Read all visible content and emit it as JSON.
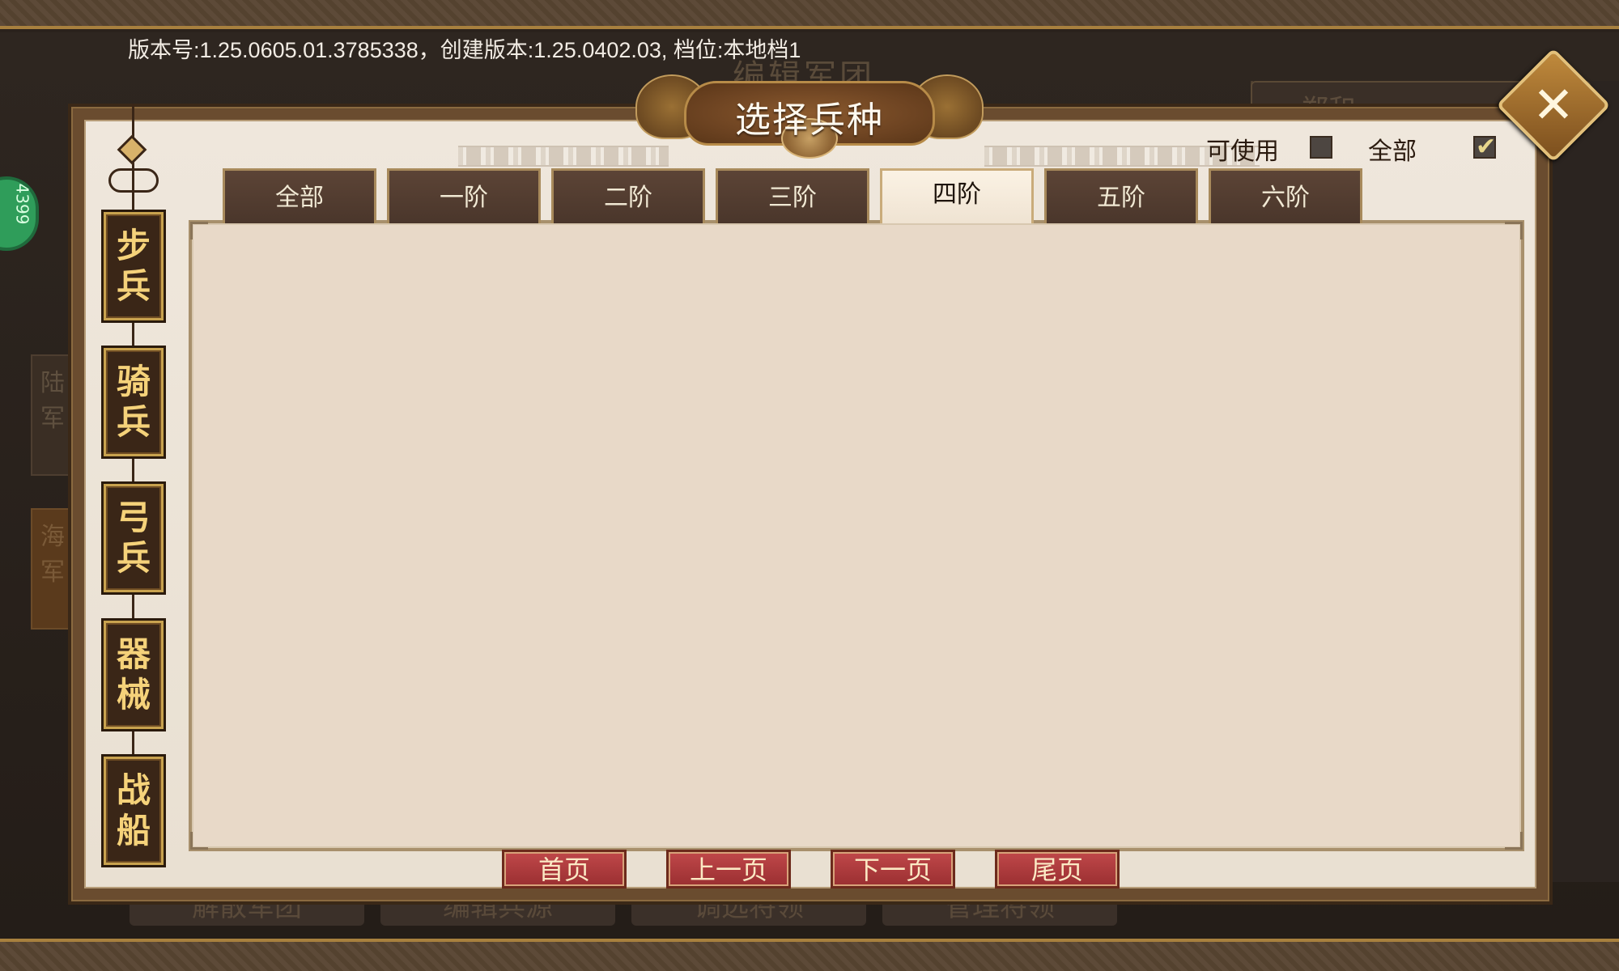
{
  "version_info": "版本号:1.25.0605.01.3785338，创建版本:1.25.0402.03, 档位:本地档1",
  "background": {
    "title": "编辑军团",
    "right_tab": "郑和",
    "badge": "4399",
    "left_tabs": [
      "陆军",
      "海军"
    ],
    "bottom_buttons": [
      "解散军团",
      "编辑兵源",
      "调选将领",
      "管理将领"
    ]
  },
  "dialog": {
    "title": "选择兵种",
    "close_label": "✕"
  },
  "filters": {
    "usable_label": "可使用",
    "usable_checked": false,
    "all_label": "全部",
    "all_checked": true
  },
  "categories": [
    {
      "label": "步兵"
    },
    {
      "label": "骑兵"
    },
    {
      "label": "弓兵"
    },
    {
      "label": "器械"
    },
    {
      "label": "战船"
    }
  ],
  "tabs": [
    {
      "label": "全部",
      "active": false
    },
    {
      "label": "一阶",
      "active": false
    },
    {
      "label": "二阶",
      "active": false
    },
    {
      "label": "三阶",
      "active": false
    },
    {
      "label": "四阶",
      "active": true
    },
    {
      "label": "五阶",
      "active": false
    },
    {
      "label": "六阶",
      "active": false
    }
  ],
  "pagination": {
    "first": "首页",
    "prev": "上一页",
    "next": "下一页",
    "last": "尾页"
  },
  "colors": {
    "accent_gold": "#c8a24e",
    "panel_bg": "#e8d9c8",
    "page_button_red": "#b03c3e"
  }
}
